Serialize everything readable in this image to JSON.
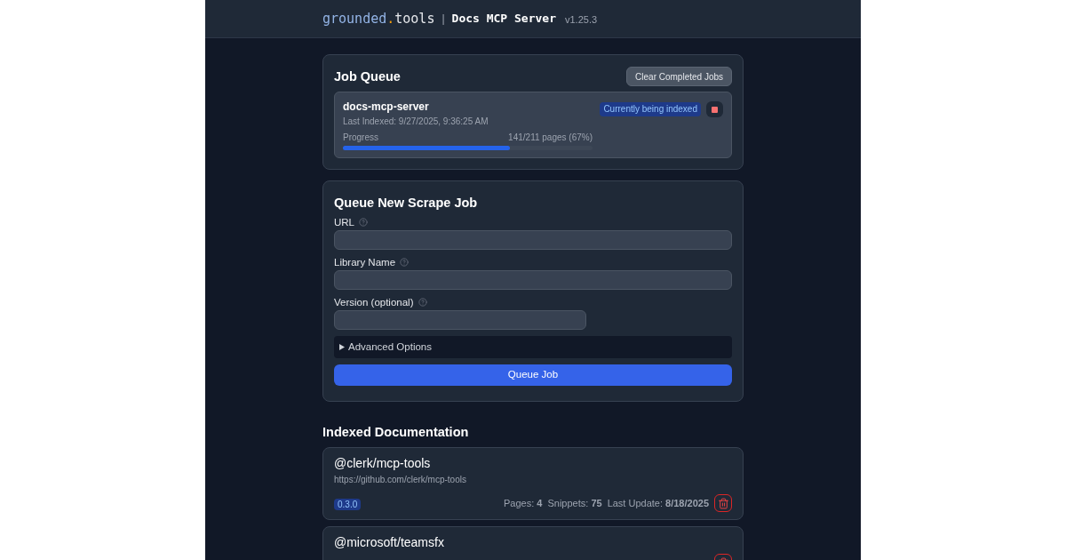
{
  "header": {
    "brand": {
      "name": "grounded",
      "dot": ".",
      "tld": "tools"
    },
    "separator": "|",
    "title": "Docs MCP Server",
    "version": "v1.25.3"
  },
  "job_queue": {
    "title": "Job Queue",
    "clear_button": "Clear Completed Jobs",
    "jobs": [
      {
        "name": "docs-mcp-server",
        "last_indexed": "Last Indexed: 9/27/2025, 9:36:25 AM",
        "status": "Currently being indexed",
        "progress_label": "Progress",
        "progress_text": "141/211 pages (67%)",
        "level": 0.67
      }
    ]
  },
  "scrape_form": {
    "title": "Queue New Scrape Job",
    "fields": [
      {
        "label": "URL",
        "kind": "wide"
      },
      {
        "label": "Library Name",
        "kind": "wide"
      },
      {
        "label": "Version (optional)",
        "kind": "short"
      }
    ],
    "advanced": {
      "label": "Advanced Options",
      "expanded": false
    },
    "submit": "Queue Job"
  },
  "indexed_docs": {
    "title": "Indexed Documentation",
    "libraries": [
      {
        "name": "@clerk/mcp-tools",
        "url": "https://github.com/clerk/mcp-tools",
        "version": "0.3.0",
        "stats": [
          "Pages: **4**",
          "Snippets: **75**",
          "Last Update: **8/18/2025**"
        ]
      },
      {
        "name": "@microsoft/teamsfx"
      }
    ]
  }
}
